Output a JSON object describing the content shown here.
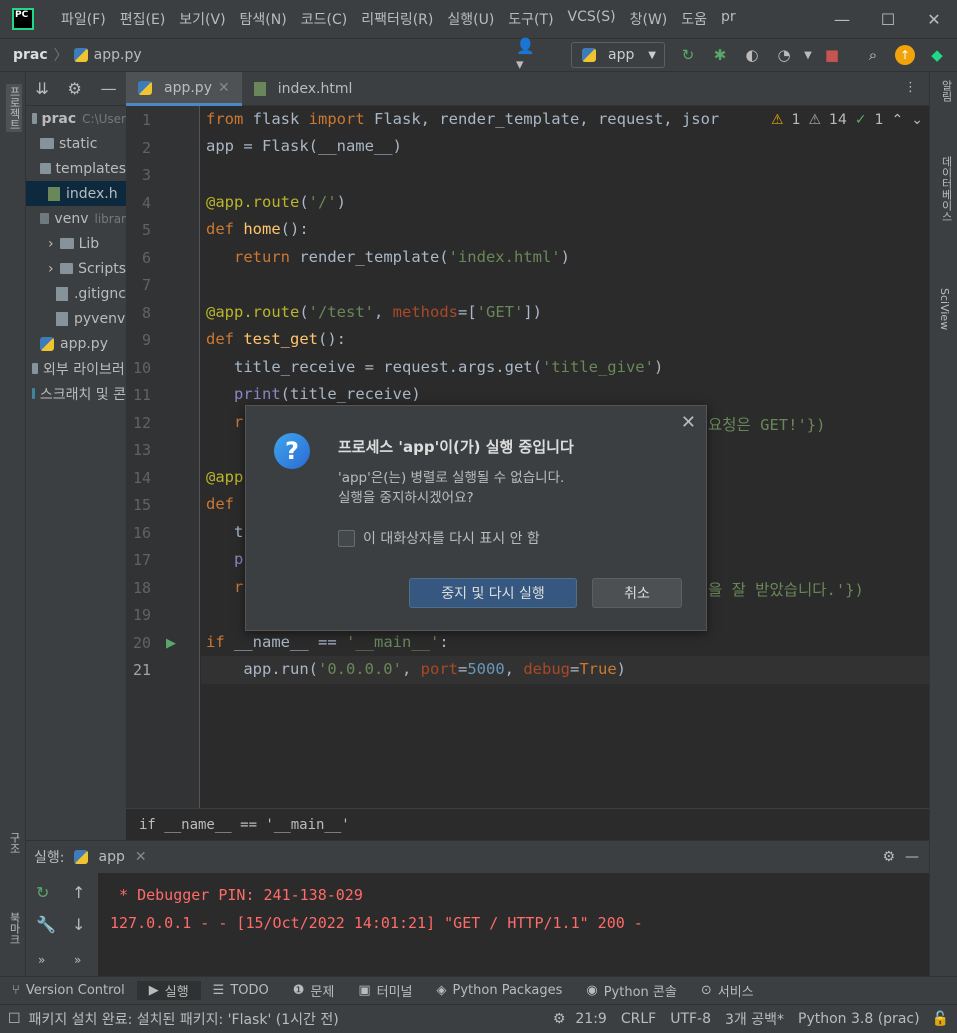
{
  "menubar": {
    "items": [
      "파일(F)",
      "편집(E)",
      "보기(V)",
      "탐색(N)",
      "코드(C)",
      "리팩터링(R)",
      "실행(U)",
      "도구(T)",
      "VCS(S)",
      "창(W)",
      "도움",
      "pr"
    ],
    "logo_text": "PC"
  },
  "navbar": {
    "project": "prac",
    "file": "app.py",
    "run_config": "app"
  },
  "left_strip": {
    "project_label": "프로젝트",
    "structure_label": "구조",
    "bookmarks_label": "북마크"
  },
  "right_strip": {
    "notifications_label": "알림",
    "database_label": "데이터베이스",
    "sciview_label": "SciView"
  },
  "project_tree": [
    {
      "label": "prac",
      "extra": "C:\\User",
      "indent": 0,
      "type": "folder-open",
      "bold": true
    },
    {
      "label": "static",
      "indent": 1,
      "type": "folder"
    },
    {
      "label": "templates",
      "indent": 1,
      "type": "folder"
    },
    {
      "label": "index.h",
      "indent": 2,
      "type": "html",
      "selected": true
    },
    {
      "label": "venv",
      "extra": "librar",
      "indent": 1,
      "type": "folder",
      "venv": true
    },
    {
      "label": "Lib",
      "indent": 2,
      "type": "folder",
      "arrow": true
    },
    {
      "label": "Scripts",
      "indent": 2,
      "type": "folder",
      "arrow": true
    },
    {
      "label": ".gitignc",
      "indent": 3,
      "type": "file"
    },
    {
      "label": "pyvenv",
      "indent": 3,
      "type": "file"
    },
    {
      "label": "app.py",
      "indent": 1,
      "type": "py"
    },
    {
      "label": "외부 라이브러",
      "indent": 0,
      "type": "lib"
    },
    {
      "label": "스크래치 및 콘",
      "indent": 0,
      "type": "scratch"
    }
  ],
  "tabs": [
    {
      "label": "app.py",
      "active": true
    },
    {
      "label": "index.html",
      "active": false
    }
  ],
  "inspections": {
    "warn1": "1",
    "warn2": "14",
    "ok": "1"
  },
  "line_numbers": [
    "1",
    "2",
    "3",
    "4",
    "5",
    "6",
    "7",
    "8",
    "9",
    "10",
    "11",
    "12",
    "13",
    "14",
    "15",
    "16",
    "17",
    "18",
    "19",
    "20",
    "21"
  ],
  "breadcrumb_bottom": "if __name__ == '__main__'",
  "run_panel": {
    "label": "실행:",
    "tab": "app",
    "console_lines": [
      " * Debugger PIN: 241-138-029",
      "127.0.0.1 - - [15/Oct/2022 14:01:21] \"GET / HTTP/1.1\" 200 -"
    ]
  },
  "tool_windows": [
    "Version Control",
    "실행",
    "TODO",
    "문제",
    "터미널",
    "Python Packages",
    "Python 콘솔",
    "서비스"
  ],
  "status": {
    "message": "패키지 설치 완료: 설치된 패키지: 'Flask' (1시간 전)",
    "position": "21:9",
    "line_sep": "CRLF",
    "encoding": "UTF-8",
    "indent": "3개 공백*",
    "interpreter": "Python 3.8 (prac)"
  },
  "dialog": {
    "title": "프로세스 'app'이(가) 실행 중입니다",
    "message_line1": "'app'은(는) 병렬로 실행될 수 없습니다.",
    "message_line2": "실행을 중지하시겠어요?",
    "checkbox_label": "이 대화상자를 다시 표시 안 함",
    "primary_button": "중지 및 다시 실행",
    "cancel_button": "취소"
  },
  "code_partial": {
    "line12_tail": "요청은 GET!'})",
    "line18_tail": "을 잘 받았습니다.'})"
  }
}
